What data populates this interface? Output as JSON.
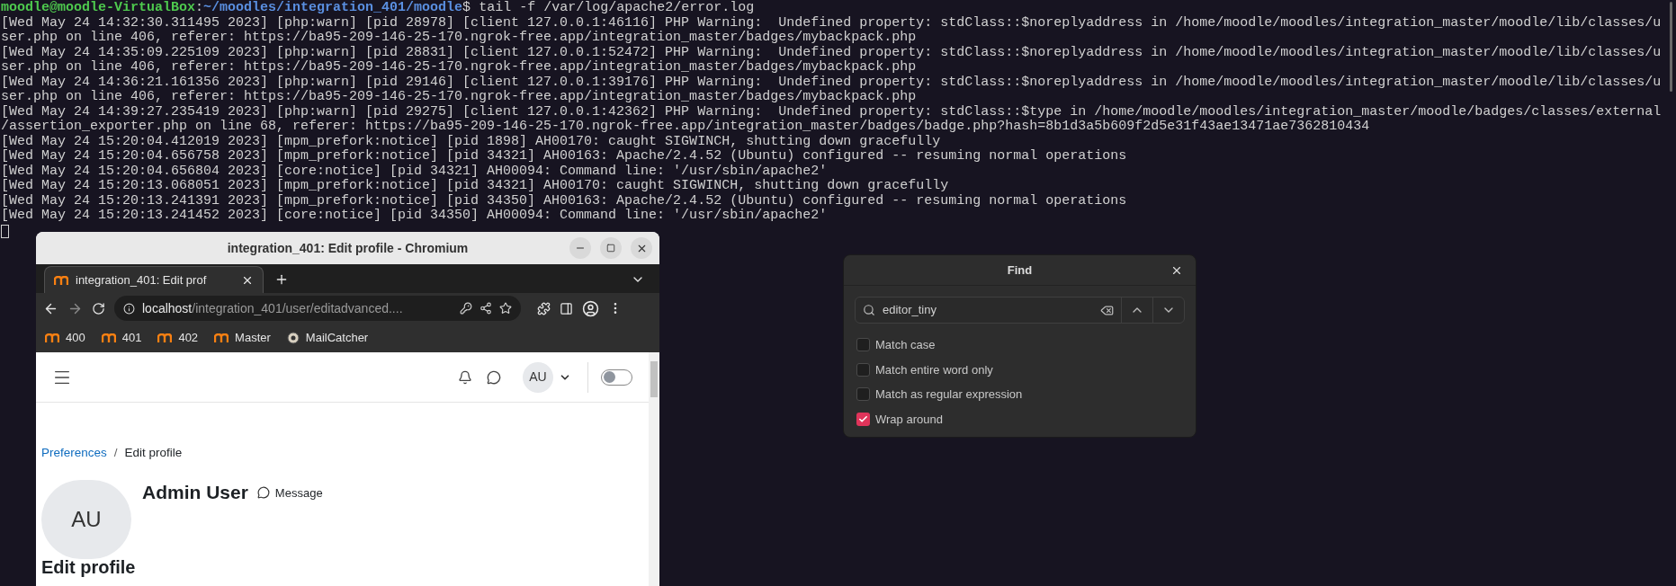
{
  "terminal": {
    "prompt": {
      "user_host": "moodle@moodle-VirtualBox",
      "separator": ":",
      "path": "~/moodles/integration_401/moodle",
      "symbol": "$",
      "command": "tail -f /var/log/apache2/error.log"
    },
    "lines": [
      "[Wed May 24 14:32:30.311495 2023] [php:warn] [pid 28978] [client 127.0.0.1:46116] PHP Warning:  Undefined property: stdClass::$noreplyaddress in /home/moodle/moodles/integration_master/moodle/lib/classes/u",
      "ser.php on line 406, referer: https://ba95-209-146-25-170.ngrok-free.app/integration_master/badges/mybackpack.php",
      "[Wed May 24 14:35:09.225109 2023] [php:warn] [pid 28831] [client 127.0.0.1:52472] PHP Warning:  Undefined property: stdClass::$noreplyaddress in /home/moodle/moodles/integration_master/moodle/lib/classes/u",
      "ser.php on line 406, referer: https://ba95-209-146-25-170.ngrok-free.app/integration_master/badges/mybackpack.php",
      "[Wed May 24 14:36:21.161356 2023] [php:warn] [pid 29146] [client 127.0.0.1:39176] PHP Warning:  Undefined property: stdClass::$noreplyaddress in /home/moodle/moodles/integration_master/moodle/lib/classes/u",
      "ser.php on line 406, referer: https://ba95-209-146-25-170.ngrok-free.app/integration_master/badges/mybackpack.php",
      "[Wed May 24 14:39:27.235419 2023] [php:warn] [pid 29275] [client 127.0.0.1:42362] PHP Warning:  Undefined property: stdClass::$type in /home/moodle/moodles/integration_master/moodle/badges/classes/external",
      "/assertion_exporter.php on line 68, referer: https://ba95-209-146-25-170.ngrok-free.app/integration_master/badges/badge.php?hash=8b1d3a5b609f2d5e31f43ae13471ae7362810434",
      "[Wed May 24 15:20:04.412019 2023] [mpm_prefork:notice] [pid 1898] AH00170: caught SIGWINCH, shutting down gracefully",
      "[Wed May 24 15:20:04.656758 2023] [mpm_prefork:notice] [pid 34321] AH00163: Apache/2.4.52 (Ubuntu) configured -- resuming normal operations",
      "[Wed May 24 15:20:04.656804 2023] [core:notice] [pid 34321] AH00094: Command line: '/usr/sbin/apache2'",
      "[Wed May 24 15:20:13.068051 2023] [mpm_prefork:notice] [pid 34321] AH00170: caught SIGWINCH, shutting down gracefully",
      "[Wed May 24 15:20:13.241391 2023] [mpm_prefork:notice] [pid 34350] AH00163: Apache/2.4.52 (Ubuntu) configured -- resuming normal operations",
      "[Wed May 24 15:20:13.241452 2023] [core:notice] [pid 34350] AH00094: Command line: '/usr/sbin/apache2'"
    ]
  },
  "browser": {
    "title": "integration_401: Edit profile - Chromium",
    "tabs": [
      {
        "label": "integration_401: Edit prof",
        "selected": true
      }
    ],
    "address": {
      "host": "localhost",
      "path": "/integration_401/user/editadvanced...."
    },
    "bookmarks": [
      {
        "label": "400",
        "kind": "moodle"
      },
      {
        "label": "401",
        "kind": "moodle"
      },
      {
        "label": "402",
        "kind": "moodle"
      },
      {
        "label": "Master",
        "kind": "moodle"
      },
      {
        "label": "MailCatcher",
        "kind": "mailcatcher"
      }
    ],
    "page": {
      "user_initials": "AU",
      "dark_mode": {
        "on": false
      },
      "breadcrumb": [
        {
          "label": "Preferences",
          "link": true
        },
        {
          "label": "Edit profile",
          "link": false
        }
      ],
      "breadcrumb_separator": "/",
      "profile": {
        "initials": "AU",
        "name": "Admin User",
        "message": "Message"
      },
      "heading": "Edit profile"
    }
  },
  "find": {
    "title": "Find",
    "query": "editor_tiny",
    "options": [
      {
        "label": "Match case",
        "checked": false
      },
      {
        "label": "Match entire word only",
        "checked": false
      },
      {
        "label": "Match as regular expression",
        "checked": false
      },
      {
        "label": "Wrap around",
        "checked": true
      }
    ]
  }
}
